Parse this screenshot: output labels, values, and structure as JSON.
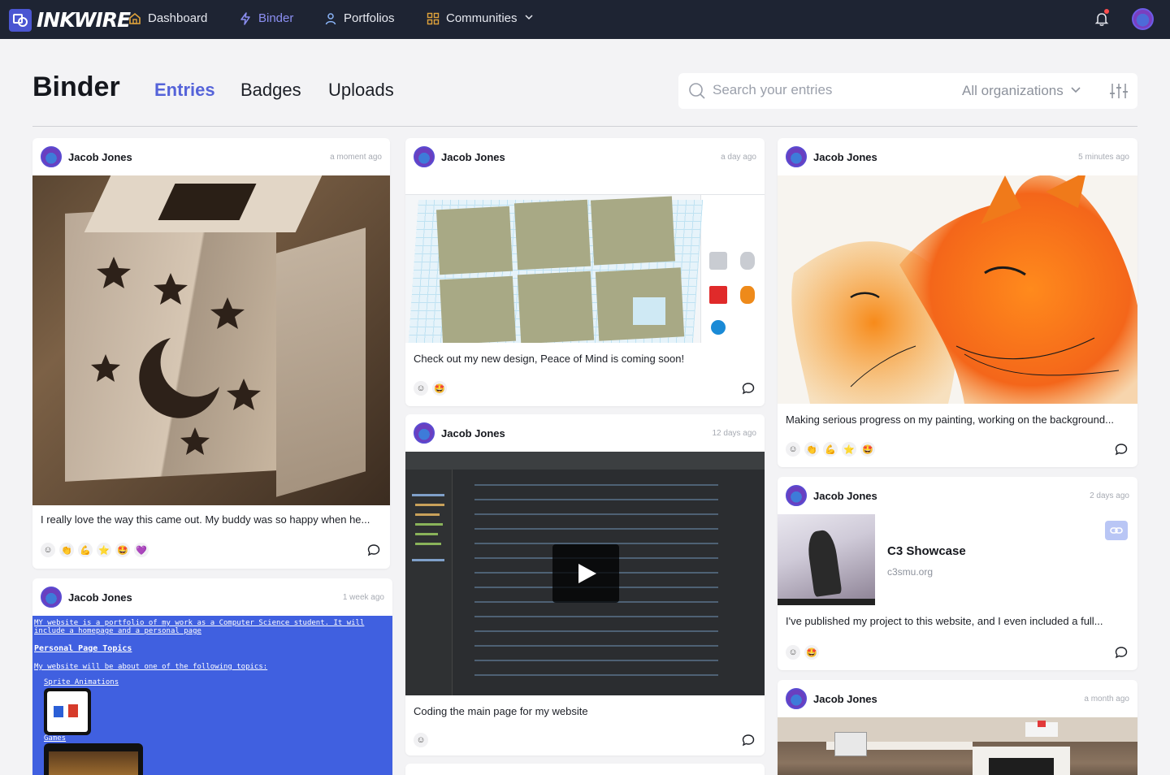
{
  "app": {
    "logo_text": "INKWIRE"
  },
  "nav": {
    "items": [
      {
        "label": "Dashboard",
        "icon": "home-icon"
      },
      {
        "label": "Binder",
        "icon": "lightning-icon"
      },
      {
        "label": "Portfolios",
        "icon": "user-icon"
      },
      {
        "label": "Communities",
        "icon": "grid-icon"
      }
    ],
    "active": "Binder",
    "notification_unread": true
  },
  "header": {
    "title": "Binder",
    "tabs": [
      "Entries",
      "Badges",
      "Uploads"
    ],
    "active_tab": "Entries",
    "search_placeholder": "Search your entries",
    "org_filter": "All organizations"
  },
  "colors": {
    "nav_bg": "#1e2433",
    "accent": "#5563d9",
    "nav_active": "#8c8ff2"
  },
  "cards": [
    {
      "author": "Jacob Jones",
      "time": "a moment ago",
      "caption": "I really love the way this  came out. My buddy was so happy when he...",
      "reactions": [
        "clap",
        "muscle",
        "star",
        "star-struck",
        "heart"
      ]
    },
    {
      "author": "Jacob Jones",
      "time": "1 week ago",
      "site_lines": [
        "MY website is a portfolio of my work as a Computer Science student. It will",
        "include a homepage and a personal page",
        "Personal Page Topics",
        "My website will be about one of the following topics:",
        "Sprite Animations",
        "Games"
      ]
    },
    {
      "author": "Jacob Jones",
      "time": "a day ago",
      "caption": "Check out my new design, Peace of Mind is coming soon!",
      "reactions": [
        "star-struck"
      ]
    },
    {
      "author": "Jacob Jones",
      "time": "12 days ago",
      "caption": "Coding the main page for my website",
      "reactions": []
    },
    {
      "author": "Jacob Jones",
      "time": "5 minutes ago",
      "caption": "Making serious progress on my painting, working on the background...",
      "reactions": [
        "clap",
        "muscle",
        "star",
        "star-struck"
      ]
    },
    {
      "author": "Jacob Jones",
      "time": "2 days ago",
      "link_title": "C3 Showcase",
      "link_url": "c3smu.org",
      "caption": "I've published my project to this website, and I even included a full...",
      "reactions": [
        "star-struck"
      ]
    },
    {
      "author": "Jacob Jones",
      "time": "a month ago"
    }
  ]
}
